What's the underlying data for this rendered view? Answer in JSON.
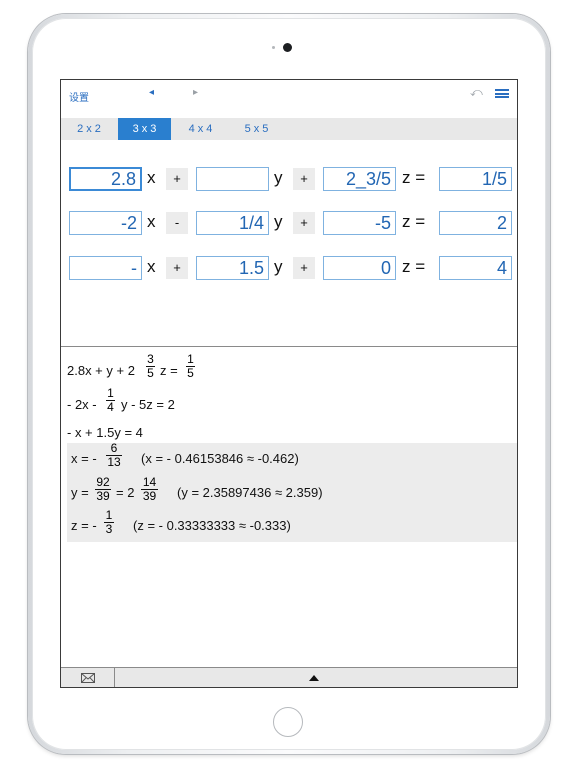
{
  "nav": {
    "settings": "设置",
    "prev_icon": "◂",
    "next_icon": "▸",
    "undo_icon": "⤺"
  },
  "tabs": [
    "2 x 2",
    "3 x 3",
    "4 x 4",
    "5 x 5"
  ],
  "active_tab": "3 x 3",
  "equations": [
    {
      "a": "2.8",
      "op1": "+",
      "b": "",
      "op2": "+",
      "c": "2_3/5",
      "rhs": "1/5"
    },
    {
      "a": "-2",
      "op1": "-",
      "b": "1/4",
      "op2": "+",
      "c": "-5",
      "rhs": "2"
    },
    {
      "a": "-",
      "op1": "+",
      "b": "1.5",
      "op2": "+",
      "c": "0",
      "rhs": "4"
    }
  ],
  "vars": {
    "x": "x",
    "y": "y",
    "z": "z ="
  },
  "display": {
    "eq1_prefix": "2.8x + y + 2",
    "eq1_f1_num": "3",
    "eq1_f1_den": "5",
    "eq1_mid": "z =",
    "eq1_f2_num": "1",
    "eq1_f2_den": "5",
    "eq2_prefix": "- 2x -",
    "eq2_f_num": "1",
    "eq2_f_den": "4",
    "eq2_suffix": "y - 5z = 2",
    "eq3": "- x + 1.5y = 4"
  },
  "solution": {
    "x_prefix": "x = -",
    "x_num": "6",
    "x_den": "13",
    "x_approx": "(x = - 0.46153846 ≈ -0.462)",
    "y_prefix": "y =",
    "y_num": "92",
    "y_den": "39",
    "y_eq": "= 2",
    "y_mnum": "14",
    "y_mden": "39",
    "y_approx": "(y = 2.35897436 ≈ 2.359)",
    "z_prefix": "z = -",
    "z_num": "1",
    "z_den": "3",
    "z_approx": "(z = - 0.33333333 ≈ -0.333)"
  },
  "colors": {
    "accent": "#2a7fcf",
    "field_text": "#2266b3"
  }
}
